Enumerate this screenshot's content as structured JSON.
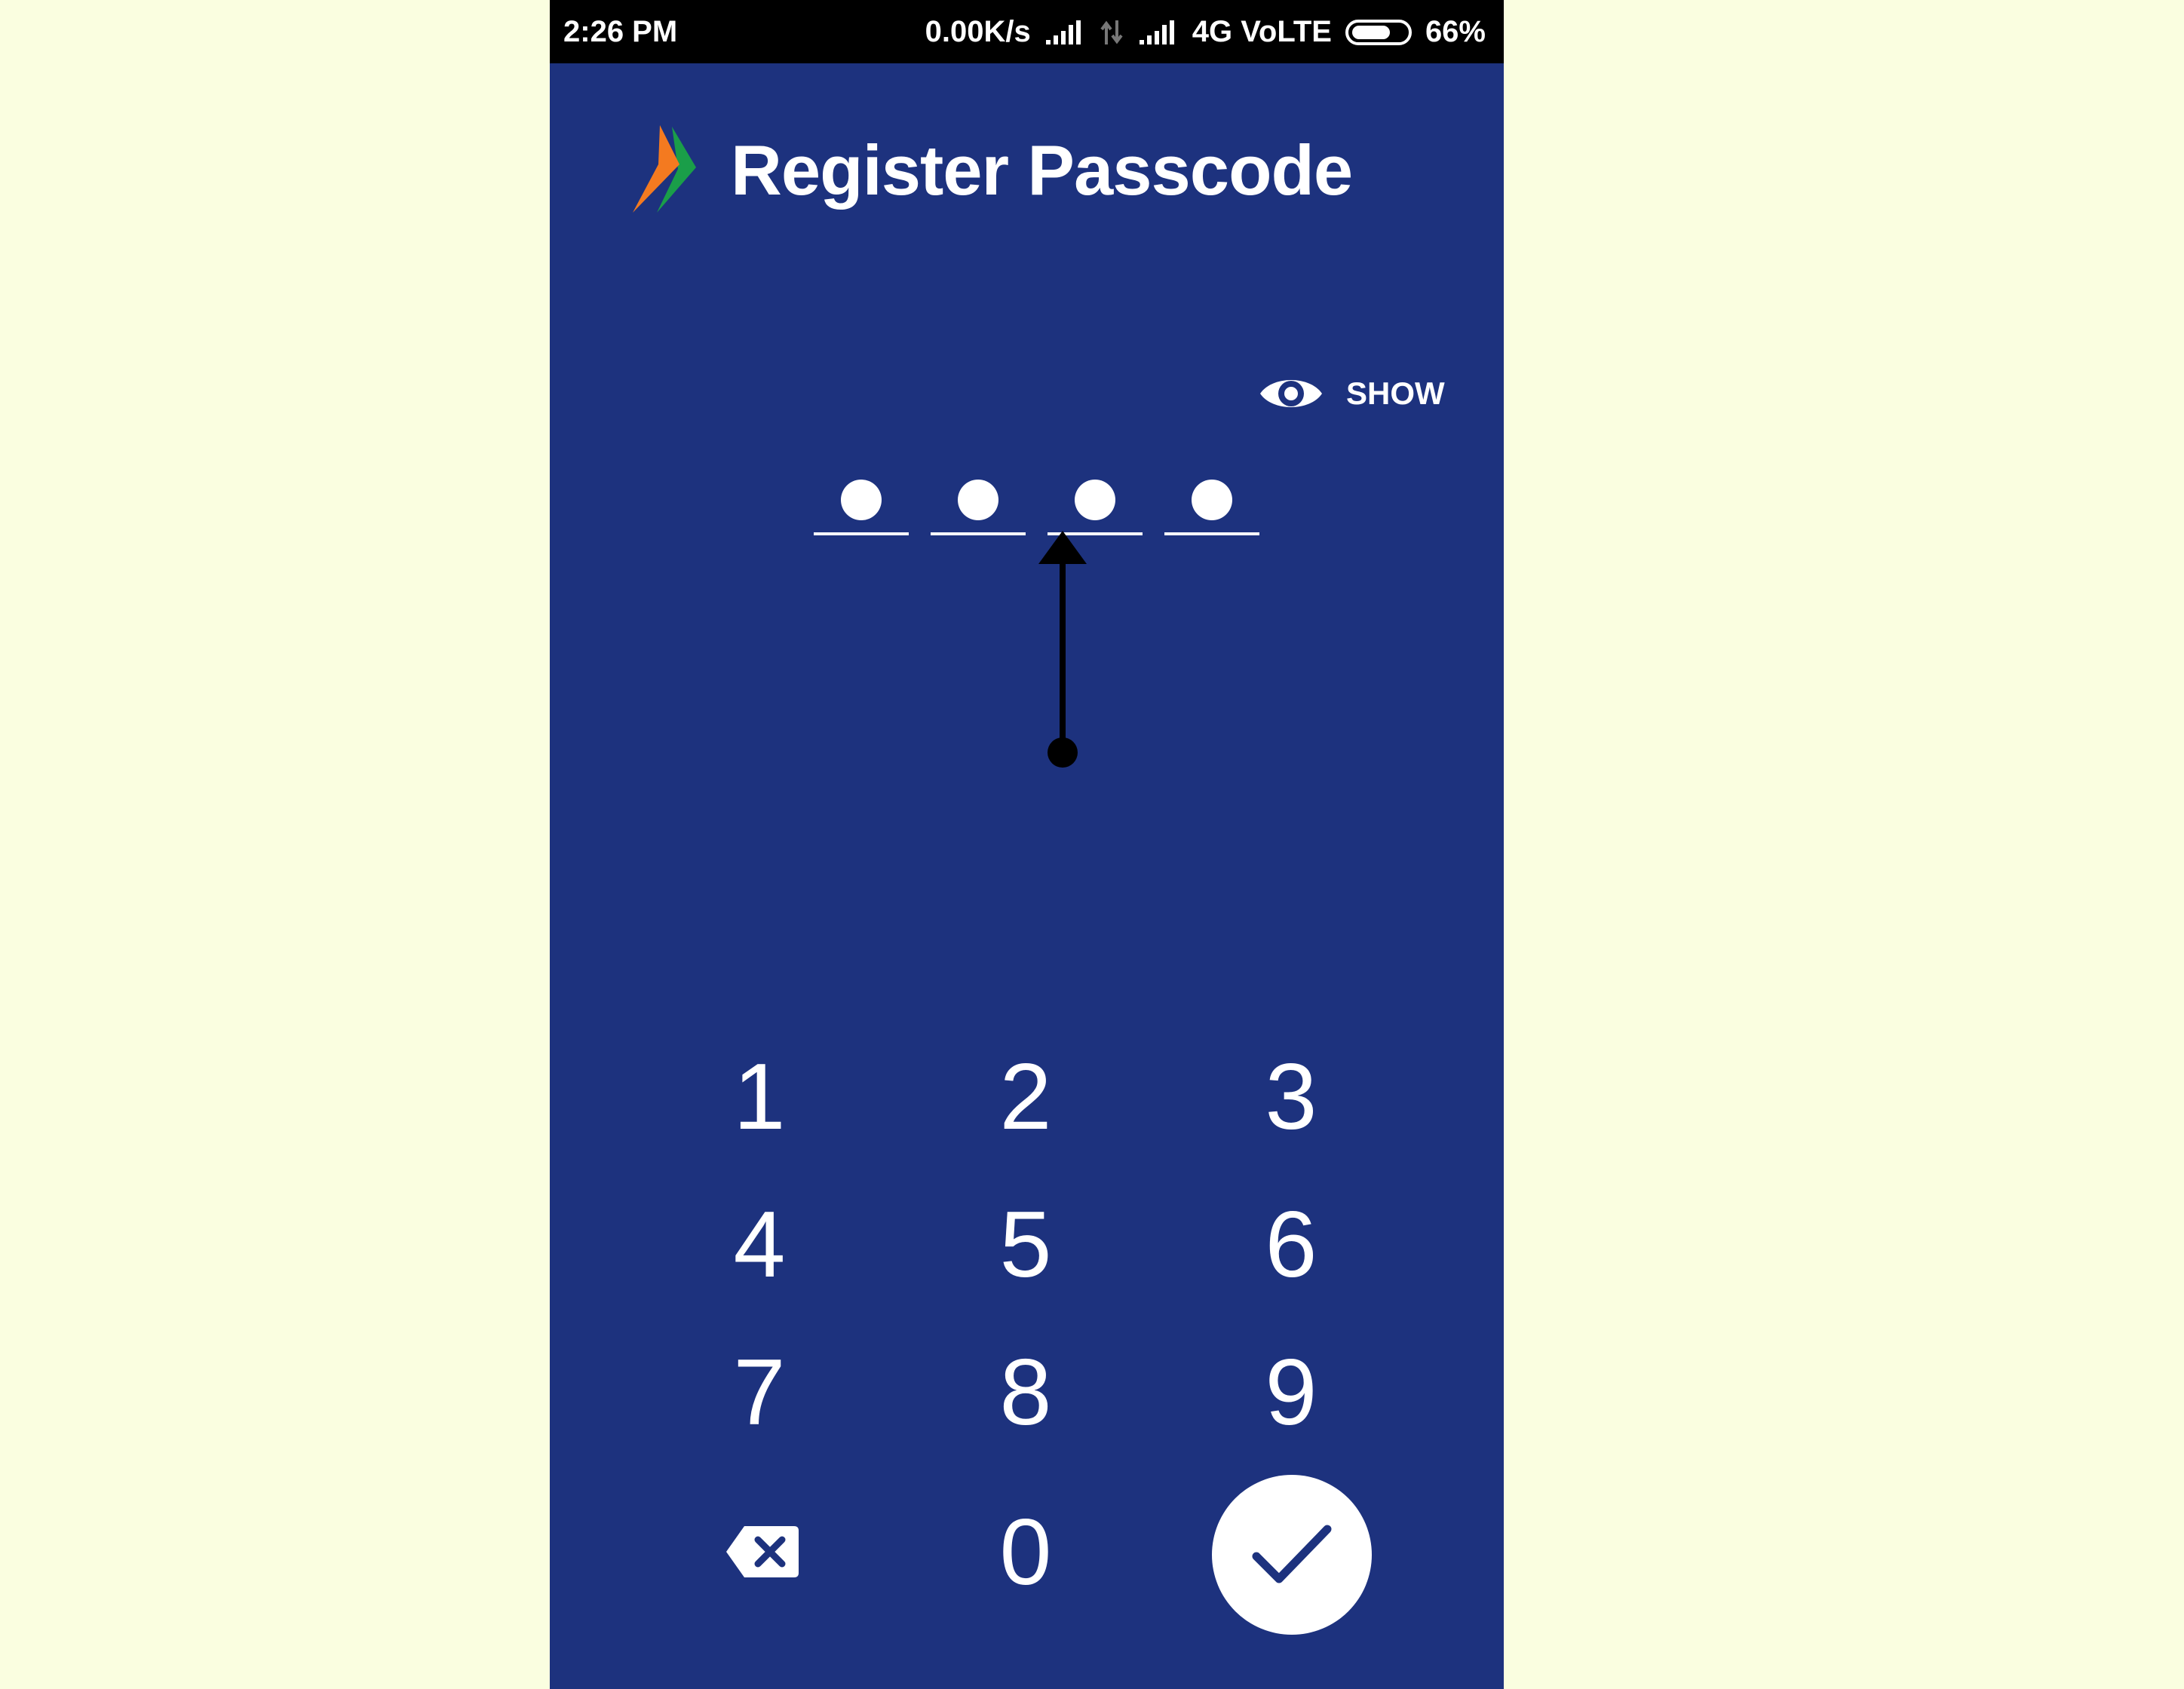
{
  "status_bar": {
    "time": "2:26 PM",
    "network_speed": "0.00K/s",
    "network_type": "4G VoLTE",
    "battery": "66%"
  },
  "header": {
    "title": "Register Passcode",
    "logo_icon": "bhim-logo-icon"
  },
  "show_toggle": {
    "label": "SHOW",
    "icon": "eye-icon"
  },
  "passcode": {
    "length": 4,
    "filled": 4
  },
  "keypad": {
    "keys": [
      "1",
      "2",
      "3",
      "4",
      "5",
      "6",
      "7",
      "8",
      "9",
      "0"
    ],
    "backspace_icon": "backspace-icon",
    "submit_icon": "check-icon"
  },
  "colors": {
    "background": "#1d327e",
    "page": "#fafee0",
    "status_bar": "#000000",
    "logo_orange": "#f47a20",
    "logo_green": "#1a9e49"
  }
}
